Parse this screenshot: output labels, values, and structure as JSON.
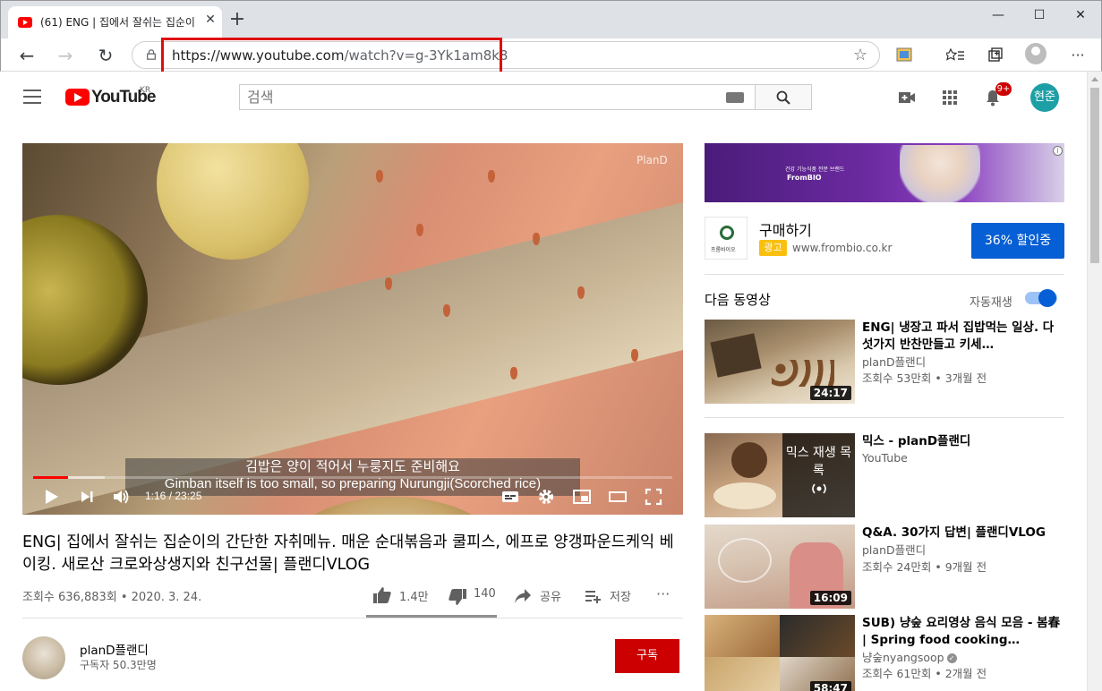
{
  "browser": {
    "tab_title": "(61) ENG | 집에서 잘쉬는 집순이",
    "tab_close": "✕",
    "new_tab": "+",
    "url_host": "https://www.youtube.com",
    "url_path": "/watch?v=g-3Yk1am8k8",
    "star": "☆",
    "win_minimize": "—",
    "win_maximize": "☐",
    "win_close": "✕",
    "more": "···"
  },
  "youtube": {
    "logo_text": "YouTube",
    "region": "KR",
    "search_placeholder": "검색",
    "notifications": "9+",
    "user_initials": "현준"
  },
  "player": {
    "watermark": "PlanD",
    "subtitle_ko": "김밥은 양이 적어서 누룽지도 준비해요",
    "subtitle_en": "Gimban itself is too small, so preparing Nurungji(Scorched rice)",
    "time": "1:16 / 23:25",
    "progress_fraction": 0.054
  },
  "video": {
    "title": "ENG| 집에서 잘쉬는 집순이의 간단한 자취메뉴. 매운 순대볶음과 쿨피스, 에프로 양갱파운드케익 베이킹. 새로산 크로와상생지와 친구선물| 플랜디VLOG",
    "views_date": "조회수 636,883회 • 2020. 3. 24.",
    "likes": "1.4만",
    "dislikes": "140",
    "share": "공유",
    "save": "저장",
    "more": "···"
  },
  "channel": {
    "name": "planD플랜디",
    "subscribers": "구독자 50.3만명",
    "subscribe": "구독"
  },
  "ad": {
    "banner_line1": "건강 기능식품 전문 브랜드",
    "banner_brand": "FromBIO",
    "info": "i",
    "logo_text": "프롬바이오",
    "title": "구매하기",
    "badge": "광고",
    "domain": "www.frombio.co.kr",
    "cta": "36% 할인중"
  },
  "sidebar": {
    "up_next": "다음 동영상",
    "autoplay": "자동재생",
    "autoplay_on": true,
    "items": [
      {
        "title": "ENG| 냉장고 파서 집밥먹는 일상. 다섯가지 반찬만들고 키세…",
        "channel": "planD플랜디",
        "meta": "조회수 53만회 • 3개월 전",
        "duration": "24:17"
      },
      {
        "title": "믹스 - planD플랜디",
        "channel": "YouTube",
        "meta": "",
        "duration": "",
        "overlay": "믹스 재생 목록"
      },
      {
        "title": "Q&A. 30가지 답변| 플랜디VLOG",
        "channel": "planD플랜디",
        "meta": "조회수 24만회 • 9개월 전",
        "duration": "16:09"
      },
      {
        "title": "SUB) 냥숲 요리영상 음식 모음 - 봄春 | Spring food cooking…",
        "channel": "냥숲nyangsoop",
        "meta": "조회수 61만회 • 2개월 전",
        "duration": "58:47"
      }
    ]
  },
  "colors": {
    "youtube_red": "#ff0000",
    "subscribe_red": "#cc0000",
    "cta_blue": "#065fd4",
    "url_highlight": "#e00d0d"
  }
}
